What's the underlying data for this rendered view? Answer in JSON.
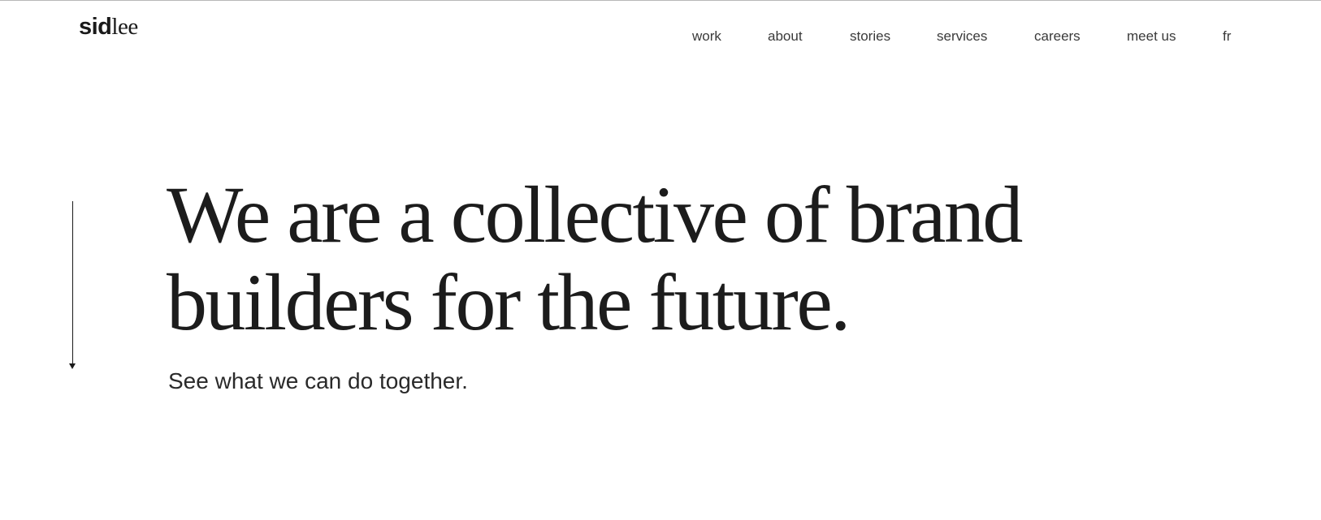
{
  "brand": {
    "logo_part1": "sid",
    "logo_part2": "lee"
  },
  "nav": {
    "items": [
      {
        "label": "work"
      },
      {
        "label": "about"
      },
      {
        "label": "stories"
      },
      {
        "label": "services"
      },
      {
        "label": "careers"
      },
      {
        "label": "meet us"
      },
      {
        "label": "fr"
      }
    ]
  },
  "hero": {
    "headline_line1": "We are a collective of brand",
    "headline_line2": "builders for the future.",
    "subheadline": "See what we can do together."
  },
  "icons": {
    "scroll_indicator": "arrow-down-icon"
  }
}
